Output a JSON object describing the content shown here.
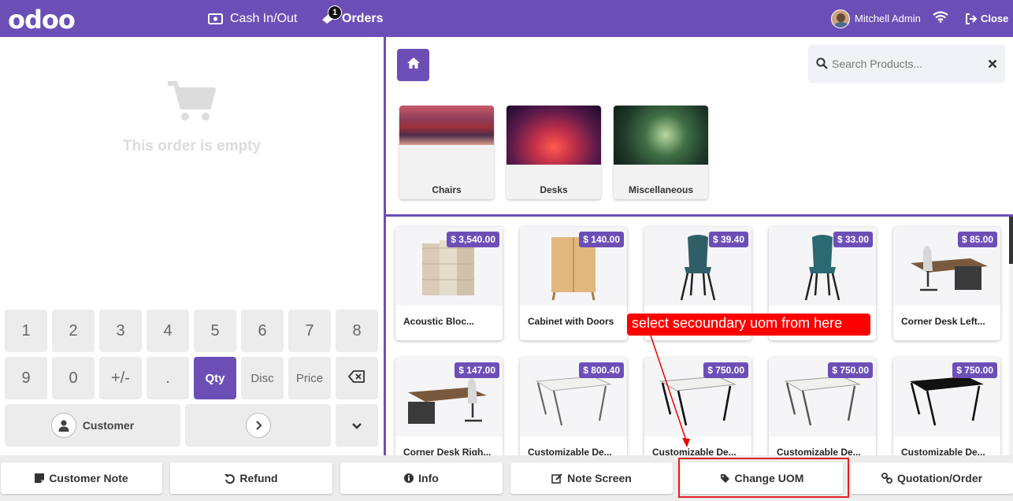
{
  "header": {
    "logo": "odoo",
    "cash_label": "Cash In/Out",
    "orders_label": "Orders",
    "orders_badge": "1",
    "user_name": "Mitchell Admin",
    "close_label": "Close",
    "brand_color": "#6c4fb6"
  },
  "order": {
    "empty_text": "This order is empty"
  },
  "numpad": {
    "row1": [
      "1",
      "2",
      "3",
      "4",
      "5",
      "6",
      "7",
      "8"
    ],
    "row2": [
      "9",
      "0",
      "+/-",
      ".",
      "Qty",
      "Disc",
      "Price"
    ],
    "customer_label": "Customer"
  },
  "search": {
    "placeholder": "Search Products..."
  },
  "categories": [
    {
      "name": "Chairs"
    },
    {
      "name": "Desks"
    },
    {
      "name": "Miscellaneous"
    }
  ],
  "products": [
    {
      "name": "Acoustic Bloc...",
      "price": "$ 3,540.00"
    },
    {
      "name": "Cabinet with Doors",
      "price": "$ 140.00"
    },
    {
      "name": "",
      "price": "$ 39.40"
    },
    {
      "name": "",
      "price": "$ 33.00"
    },
    {
      "name": "Corner Desk Left...",
      "price": "$ 85.00"
    },
    {
      "name": "Corner Desk Righ...",
      "price": "$ 147.00"
    },
    {
      "name": "Customizable De...",
      "price": "$ 800.40"
    },
    {
      "name": "Customizable De...",
      "price": "$ 750.00"
    },
    {
      "name": "Customizable De...",
      "price": "$ 750.00"
    },
    {
      "name": "Customizable De...",
      "price": "$ 750.00"
    }
  ],
  "annotation": {
    "text": "select  secoundary uom from here",
    "color": "#ff0000"
  },
  "control_buttons": [
    {
      "label": "Customer Note",
      "icon": "note-icon"
    },
    {
      "label": "Refund",
      "icon": "undo-icon"
    },
    {
      "label": "Info",
      "icon": "info-icon"
    },
    {
      "label": "Note Screen",
      "icon": "edit-icon"
    },
    {
      "label": "Change UOM",
      "icon": "tag-icon"
    },
    {
      "label": "Quotation/Order",
      "icon": "link-icon"
    }
  ]
}
